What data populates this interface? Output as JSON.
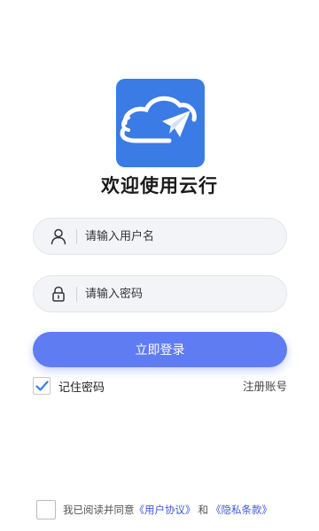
{
  "app": {
    "title": "欢迎使用云行",
    "brand_color": "#3a7be5",
    "accent_color": "#5f7cf2"
  },
  "form": {
    "username": {
      "placeholder": "请输入用户名",
      "value": "",
      "icon": "user-icon"
    },
    "password": {
      "placeholder": "请输入密码",
      "value": "",
      "icon": "lock-icon"
    },
    "login_label": "立即登录",
    "remember": {
      "label": "记住密码",
      "checked": true
    },
    "register_label": "注册账号"
  },
  "agreement": {
    "checked": false,
    "prefix": "我已阅读并同意",
    "user_agreement": "《用户协议》",
    "and": "和",
    "privacy_policy": "《隐私条款》"
  }
}
